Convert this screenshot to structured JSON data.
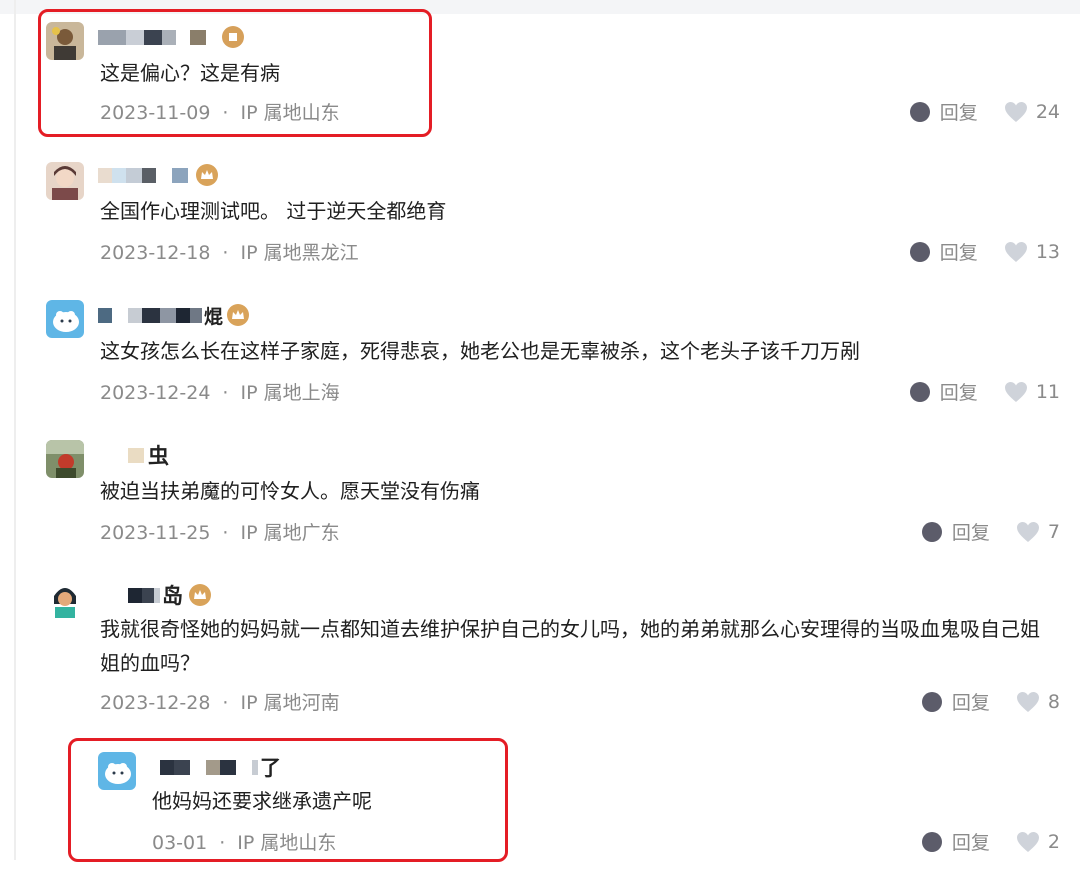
{
  "comments": [
    {
      "username": "",
      "text": "这是偏心？这是有病",
      "date": "2023-11-09",
      "location": "IP 属地山东",
      "reply_label": "回复",
      "likes": "24"
    },
    {
      "username": "",
      "text": "全国作心理测试吧。 过于逆天全都绝育",
      "date": "2023-12-18",
      "location": "IP 属地黑龙江",
      "reply_label": "回复",
      "likes": "13"
    },
    {
      "username": "焜",
      "text": "这女孩怎么长在这样子家庭，死得悲哀，她老公也是无辜被杀，这个老头子该千刀万剐",
      "date": "2023-12-24",
      "location": "IP 属地上海",
      "reply_label": "回复",
      "likes": "11"
    },
    {
      "username": "虫",
      "text": "被迫当扶弟魔的可怜女人。愿天堂没有伤痛",
      "date": "2023-11-25",
      "location": "IP 属地广东",
      "reply_label": "回复",
      "likes": "7"
    },
    {
      "username": "岛",
      "text": "我就很奇怪她的妈妈就一点都知道去维护保护自己的女儿吗，她的弟弟就那么心安理得的当吸血鬼吸自己姐姐的血吗？",
      "date": "2023-12-28",
      "location": "IP 属地河南",
      "reply_label": "回复",
      "likes": "8"
    }
  ],
  "reply": {
    "username": "了",
    "text": "他妈妈还要求继承遗产呢",
    "date": "03-01",
    "location": "IP 属地山东",
    "reply_label": "回复",
    "likes": "2"
  },
  "separator": "·",
  "colors": {
    "highlight": "#e41d25",
    "meta": "#8a8a8a",
    "badge": "#d9a35a",
    "icon_dark": "#5c5c6a",
    "heart": "#cfd3da"
  }
}
